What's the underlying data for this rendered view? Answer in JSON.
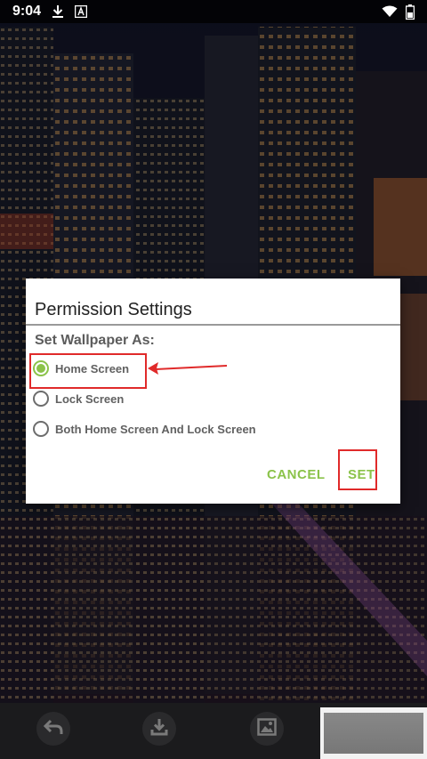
{
  "status_bar": {
    "time": "9:04",
    "icons": [
      "download-icon",
      "font-a-icon",
      "wifi-icon",
      "battery-icon"
    ]
  },
  "dialog": {
    "title": "Permission Settings",
    "subtitle": "Set Wallpaper As:",
    "options": [
      {
        "label": "Home Screen",
        "checked": true
      },
      {
        "label": "Lock Screen",
        "checked": false
      },
      {
        "label": "Both Home Screen And Lock Screen",
        "checked": false
      }
    ],
    "cancel_label": "CANCEL",
    "set_label": "SET"
  },
  "toolbar": {
    "buttons": [
      "undo-icon",
      "download-icon",
      "image-icon"
    ]
  },
  "colors": {
    "accent": "#8bc34a",
    "annotation_red": "#e02a2a"
  }
}
